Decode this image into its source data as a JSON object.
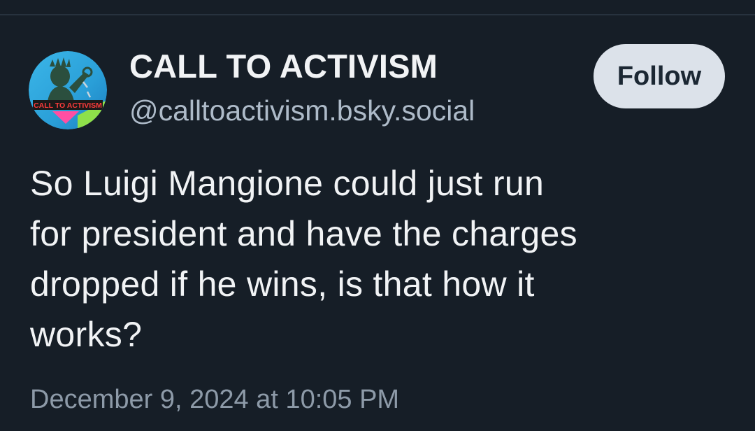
{
  "author": {
    "display_name": "CALL TO ACTIVISM",
    "handle": "@calltoactivism.bsky.social",
    "avatar_text": "CALL TO ACTIVISM"
  },
  "actions": {
    "follow_label": "Follow"
  },
  "post": {
    "lines": [
      "So Luigi Mangione could just run",
      "for president and have the charges",
      "dropped if he wins, is that how it",
      "works?"
    ],
    "timestamp": "December 9, 2024 at 10:05 PM"
  },
  "colors": {
    "background": "#161e27",
    "text": "#f1f3f5",
    "handle": "#aebbc9",
    "follow_bg": "#dce2ea"
  }
}
